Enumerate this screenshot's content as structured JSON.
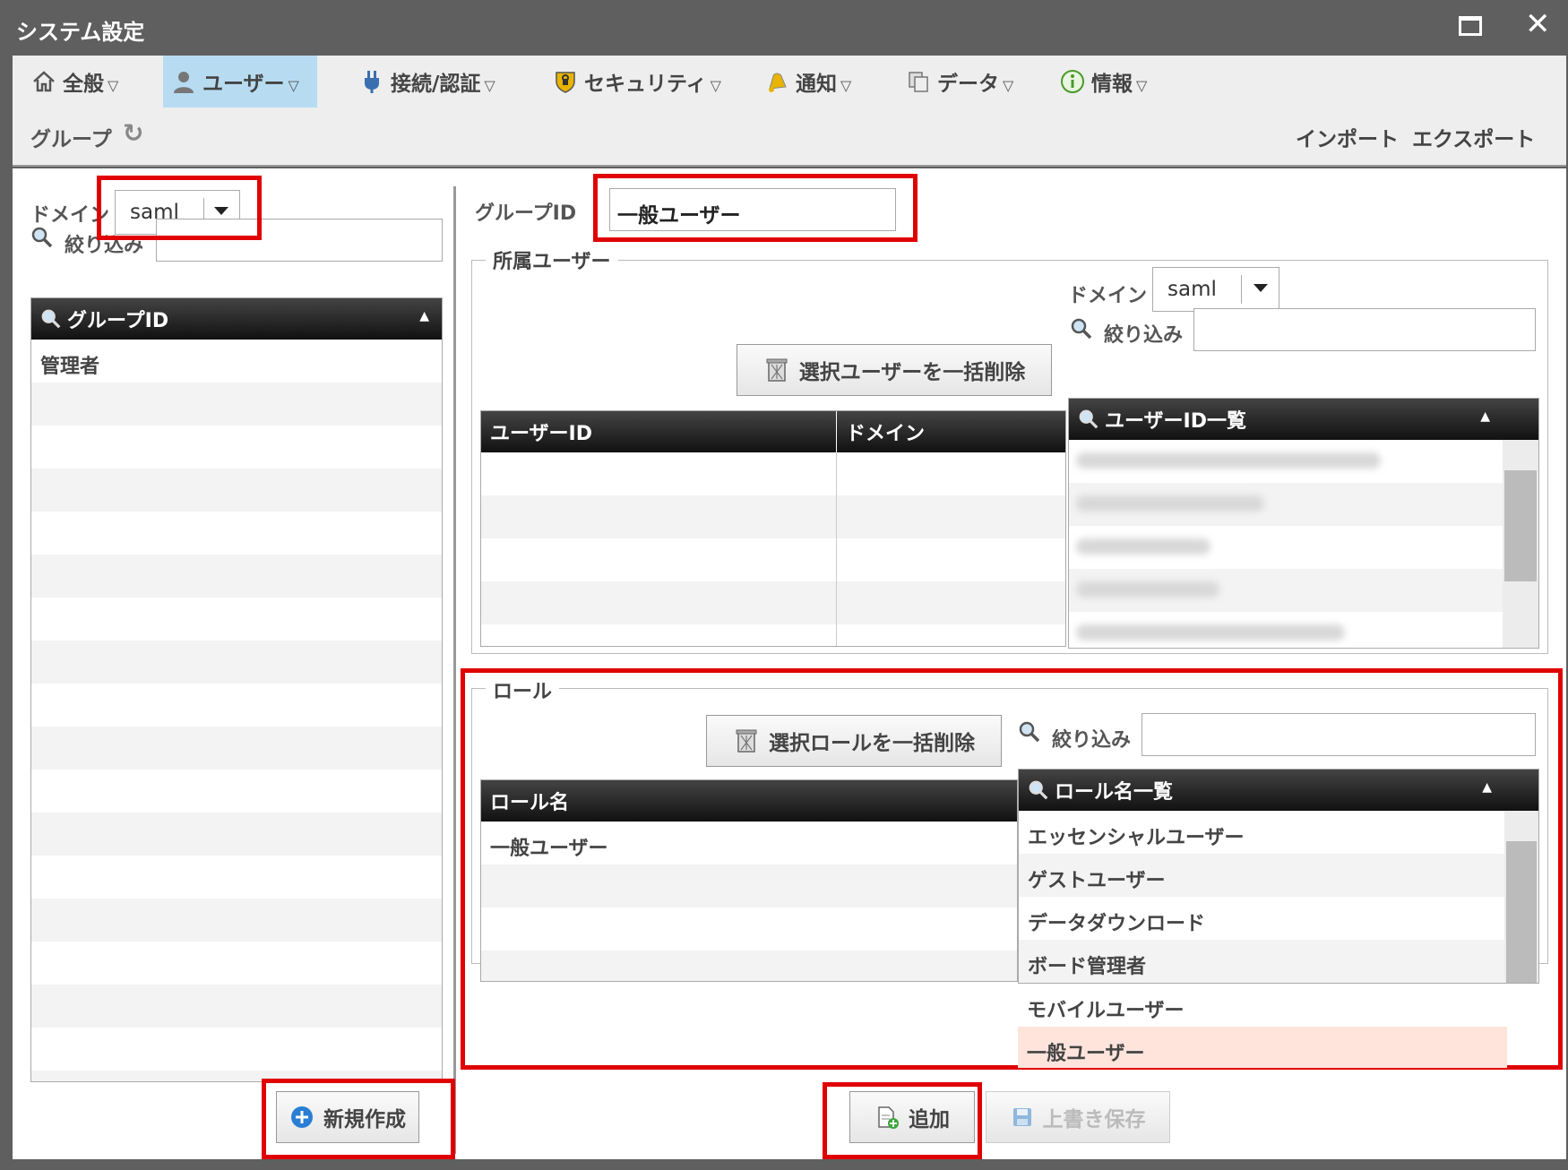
{
  "window": {
    "title": "システム設定"
  },
  "tabs": [
    {
      "label": "全般",
      "icon": "home-icon"
    },
    {
      "label": "ユーザー",
      "icon": "user-icon",
      "active": true
    },
    {
      "label": "接続/認証",
      "icon": "plug-icon"
    },
    {
      "label": "セキュリティ",
      "icon": "shield-icon"
    },
    {
      "label": "通知",
      "icon": "bell-icon"
    },
    {
      "label": "データ",
      "icon": "copy-icon"
    },
    {
      "label": "情報",
      "icon": "info-icon"
    }
  ],
  "subbar": {
    "group_label": "グループ",
    "import_label": "インポート",
    "export_label": "エクスポート"
  },
  "left": {
    "domain_label": "ドメイン",
    "domain_value": "saml",
    "filter_label": "絞り込み",
    "filter_value": "",
    "list_header": "グループID",
    "groups": [
      "管理者"
    ],
    "new_button": "新規作成"
  },
  "right": {
    "group_id_label": "グループID",
    "group_id_value": "一般ユーザー",
    "members": {
      "legend": "所属ユーザー",
      "domain_label": "ドメイン",
      "domain_value": "saml",
      "bulk_delete_label": "選択ユーザーを一括削除",
      "filter_label": "絞り込み",
      "filter_value": "",
      "col_user_id": "ユーザーID",
      "col_domain": "ドメイン",
      "user_list_header": "ユーザーID一覧"
    },
    "roles": {
      "legend": "ロール",
      "bulk_delete_label": "選択ロールを一括削除",
      "filter_label": "絞り込み",
      "filter_value": "",
      "col_role_name": "ロール名",
      "assigned": [
        "一般ユーザー"
      ],
      "role_list_header": "ロール名一覧",
      "available": [
        "エッセンシャルユーザー",
        "ゲストユーザー",
        "データダウンロード",
        "ボード管理者",
        "モバイルユーザー",
        "一般ユーザー"
      ],
      "selected_index": 5
    },
    "add_button": "追加",
    "save_button": "上書き保存"
  },
  "colors": {
    "active_tab": "#b7dcf2",
    "highlight": "#e00000",
    "selected_row": "#ffe4dc"
  }
}
